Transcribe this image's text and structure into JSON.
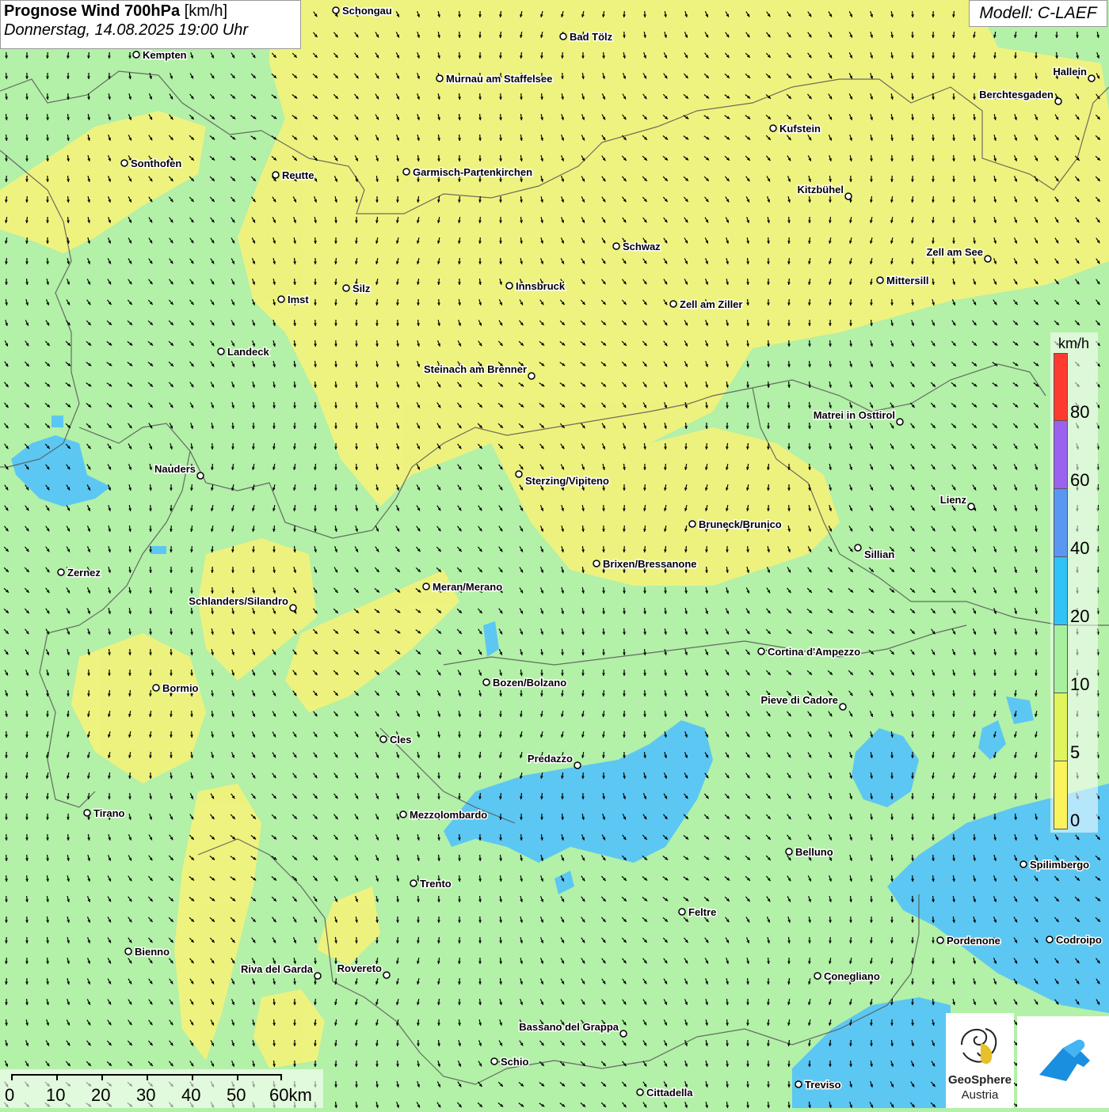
{
  "header": {
    "title_bold": "Prognose Wind 700hPa",
    "title_unit": "[km/h]",
    "date": "Donnerstag, 14.08.2025 19:00 Uhr",
    "model": "Modell: C-LAEF"
  },
  "legend": {
    "unit": "km/h",
    "labels": [
      "80",
      "60",
      "40",
      "20",
      "10",
      "5",
      "0"
    ],
    "colors": [
      "#ff3b30",
      "#9a62ee",
      "#5a97f2",
      "#30c4f6",
      "#a6f09e",
      "#e0f45c",
      "#fbf35c"
    ]
  },
  "scale": {
    "labels": [
      "0",
      "10",
      "20",
      "30",
      "40",
      "50",
      "60km"
    ]
  },
  "branding": {
    "name_line1": "GeoSphere",
    "name_line2": "Austria"
  },
  "colors": {
    "background": "#b3f0a8",
    "yellow_zone": "#f4f37a",
    "blue_zone": "#5cc7f2",
    "border": "#555555"
  },
  "cities": [
    "Schongau",
    "Bad Tölz",
    "Kempten",
    "Murnau am Staffelsee",
    "Hallein",
    "Berchtesgaden",
    "Kufstein",
    "Sonthofen",
    "Reutte",
    "Garmisch-Partenkirchen",
    "Kitzbühel",
    "Schwaz",
    "Zell am See",
    "Mittersill",
    "Silz",
    "Innsbruck",
    "Imst",
    "Zell am Ziller",
    "Landeck",
    "Steinach am Brenner",
    "Matrei in Osttirol",
    "Nauders",
    "Sterzing/Vipiteno",
    "Lienz",
    "Bruneck/Brunico",
    "Sillian",
    "Brixen/Bressanone",
    "Zernez",
    "Meran/Merano",
    "Schlanders/Silandro",
    "Cortina d'Ampezzo",
    "Bozen/Bolzano",
    "Pieve di Cadore",
    "Bormio",
    "Cles",
    "Predazzo",
    "Tirano",
    "Mezzolombardo",
    "Belluno",
    "Spilimbergo",
    "Trento",
    "Feltre",
    "Pordenone",
    "Codroipo",
    "Bienno",
    "Riva del Garda",
    "Rovereto",
    "Conegliano",
    "Bassano del Grappa",
    "Schio",
    "Treviso",
    "Cittadella"
  ]
}
